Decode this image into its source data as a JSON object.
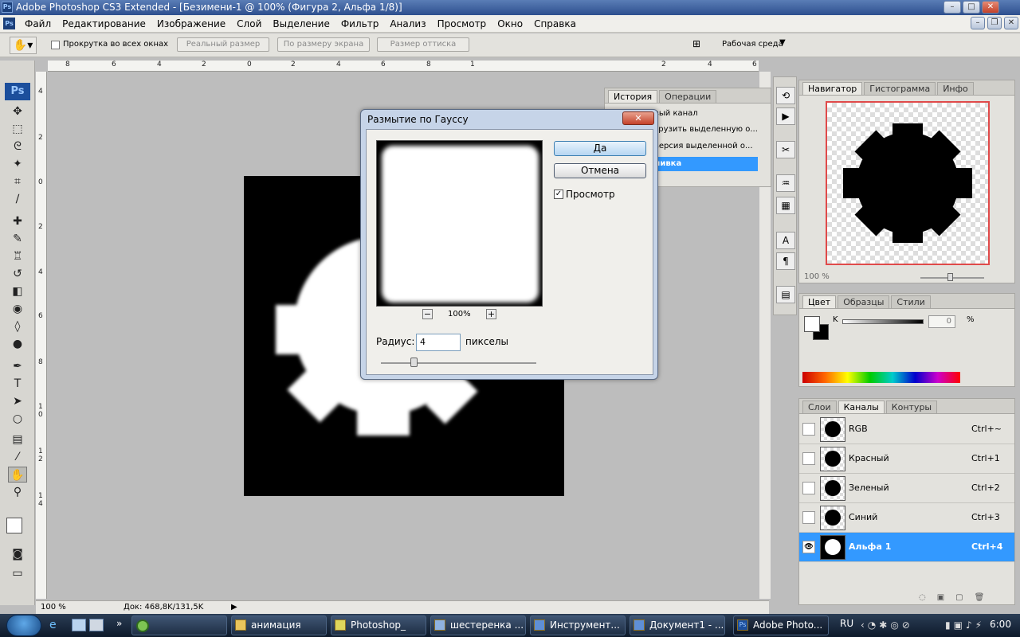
{
  "window": {
    "title": "Adobe Photoshop CS3 Extended - [Безимени-1 @ 100% (Фигура 2, Альфа 1/8)]",
    "minimize": "–",
    "maximize": "□",
    "close": "✕",
    "doc_minimize": "–",
    "doc_restore": "❐",
    "doc_close": "✕"
  },
  "menu": [
    "Файл",
    "Редактирование",
    "Изображение",
    "Слой",
    "Выделение",
    "Фильтр",
    "Анализ",
    "Просмотр",
    "Окно",
    "Справка"
  ],
  "options": {
    "scroll_all": "Прокрутка во всех окнах",
    "actual_pixels": "Реальный размер",
    "fit_screen": "По размеру экрана",
    "print_size": "Размер оттиска",
    "workspace": "Рабочая среда"
  },
  "ruler_top": [
    "8",
    "6",
    "4",
    "2",
    "0",
    "2",
    "4",
    "6",
    "8",
    "1",
    "2",
    "4",
    "6"
  ],
  "ruler_left": [
    "4",
    "2",
    "0",
    "2",
    "4",
    "6",
    "8",
    "1",
    "0",
    "1",
    "2",
    "1",
    "4"
  ],
  "status": {
    "zoom": "100 %",
    "doc": "Док: 468,8K/131,5K"
  },
  "dialog": {
    "title": "Размытие по Гауссу",
    "close": "✕",
    "ok": "Да",
    "cancel": "Отмена",
    "preview_label": "Просмотр",
    "preview_checked": true,
    "zoom": "100%",
    "zoom_out": "−",
    "zoom_in": "+",
    "radius_label": "Радиус:",
    "radius_value": "4",
    "radius_unit": "пикселы"
  },
  "history_panel": {
    "tabs": [
      "История",
      "Операции"
    ],
    "items": [
      "вый канал",
      "грузить выделенную о...",
      "версия выделенной о...",
      "ливка"
    ]
  },
  "navigator_panel": {
    "tabs": [
      "Навигатор",
      "Гистограмма",
      "Инфо"
    ],
    "zoom": "100 %"
  },
  "color_panel": {
    "tabs": [
      "Цвет",
      "Образцы",
      "Стили"
    ],
    "channel": "K",
    "value": "0",
    "unit": "%"
  },
  "channels_panel": {
    "tabs": [
      "Слои",
      "Каналы",
      "Контуры"
    ],
    "rows": [
      {
        "name": "RGB",
        "key": "Ctrl+~"
      },
      {
        "name": "Красный",
        "key": "Ctrl+1"
      },
      {
        "name": "Зеленый",
        "key": "Ctrl+2"
      },
      {
        "name": "Синий",
        "key": "Ctrl+3"
      },
      {
        "name": "Альфа 1",
        "key": "Ctrl+4"
      }
    ]
  },
  "taskbar": {
    "items": [
      "анимация",
      "Photoshop_",
      "шестеренка ...",
      "Инструмент...",
      "Документ1 - ...",
      "Adobe Photo..."
    ],
    "lang": "RU",
    "time": "6:00",
    "more": "»"
  },
  "colors": {
    "selection": "#3399ff",
    "title_bar": "#2d4f8e"
  }
}
